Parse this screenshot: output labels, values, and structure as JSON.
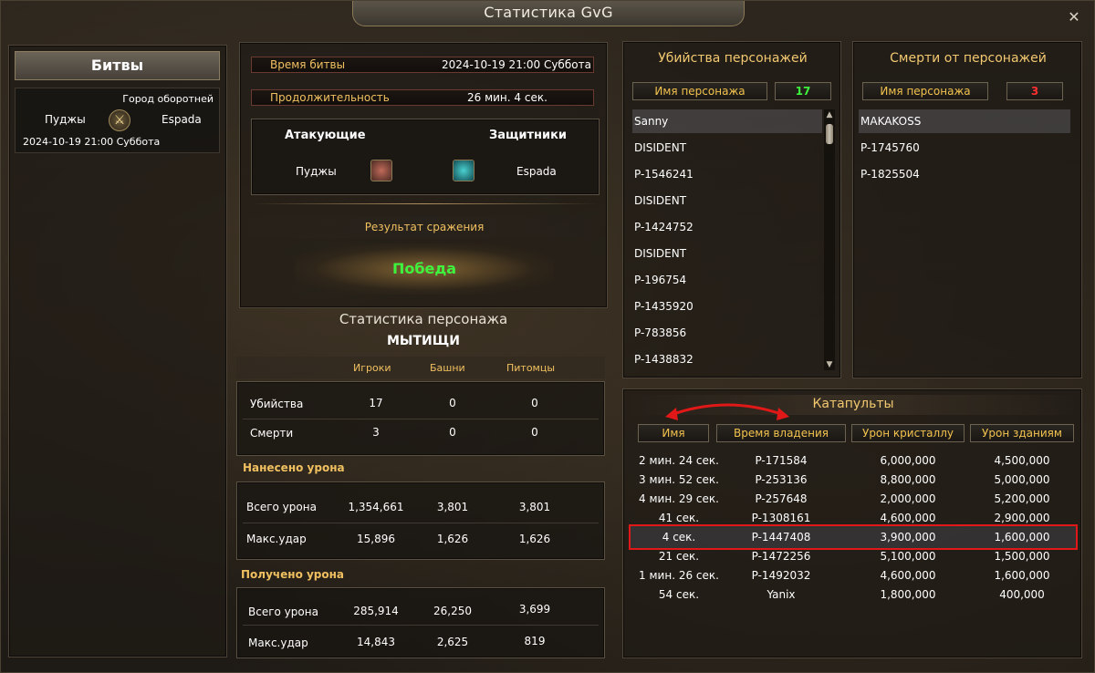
{
  "window": {
    "title": "Статистика GvG",
    "close_icon": "close-icon"
  },
  "battles": {
    "header": "Битвы",
    "entry": {
      "location": "Город оборотней",
      "attacker": "Пуджы",
      "defender": "Espada",
      "datetime": "2024-10-19 21:00 Суббота"
    }
  },
  "battle_info": {
    "time_label": "Время битвы",
    "time_value": "2024-10-19 21:00 Суббота",
    "duration_label": "Продолжительность",
    "duration_value": "26 мин. 4 сек.",
    "attackers_label": "Атакующие",
    "defenders_label": "Защитники",
    "attacker_name": "Пуджы",
    "defender_name": "Espada",
    "result_label": "Результат сражения",
    "result_value": "Победа"
  },
  "char_stats": {
    "title": "Статистика персонажа",
    "name": "МЫТИЩИ",
    "columns": [
      "Игроки",
      "Башни",
      "Питомцы"
    ],
    "rows": [
      {
        "label": "Убийства",
        "values": [
          "17",
          "0",
          "0"
        ]
      },
      {
        "label": "Смерти",
        "values": [
          "3",
          "0",
          "0"
        ]
      }
    ],
    "damage_dealt_label": "Нанесено урона",
    "damage_dealt": [
      {
        "label": "Всего урона",
        "values": [
          "1,354,661",
          "3,801",
          "3,801"
        ]
      },
      {
        "label": "Макс.удар",
        "values": [
          "15,896",
          "1,626",
          "1,626"
        ]
      }
    ],
    "damage_taken_label": "Получено урона",
    "damage_taken": [
      {
        "label": "Всего урона",
        "values": [
          "285,914",
          "26,250",
          "3,699"
        ]
      },
      {
        "label": "Макс.удар",
        "values": [
          "14,843",
          "2,625",
          "819"
        ]
      }
    ]
  },
  "kills": {
    "title": "Убийства персонажей",
    "col_label": "Имя персонажа",
    "count": "17",
    "items": [
      "Sanny",
      "DISIDENT",
      "P-1546241",
      "DISIDENT",
      "P-1424752",
      "DISIDENT",
      "P-196754",
      "P-1435920",
      "P-783856",
      "P-1438832"
    ]
  },
  "deaths": {
    "title": "Смерти от персонажей",
    "col_label": "Имя персонажа",
    "count": "3",
    "items": [
      "MAKAKOSS",
      "P-1745760",
      "P-1825504"
    ]
  },
  "catapults": {
    "title": "Катапульты",
    "columns": [
      "Имя",
      "Время владения",
      "Урон кристаллу",
      "Урон зданиям"
    ],
    "rows": [
      [
        "2 мин. 24 сек.",
        "P-171584",
        "6,000,000",
        "4,500,000"
      ],
      [
        "3 мин. 52 сек.",
        "P-253136",
        "8,800,000",
        "5,000,000"
      ],
      [
        "4 мин. 29 сек.",
        "P-257648",
        "2,000,000",
        "5,200,000"
      ],
      [
        "41 сек.",
        "P-1308161",
        "4,600,000",
        "2,900,000"
      ],
      [
        "4 сек.",
        "P-1447408",
        "3,900,000",
        "1,600,000"
      ],
      [
        "21 сек.",
        "P-1472256",
        "5,100,000",
        "1,500,000"
      ],
      [
        "1 мин. 26 сек.",
        "P-1492032",
        "4,600,000",
        "1,600,000"
      ],
      [
        "54 сек.",
        "Yanix",
        "1,800,000",
        "400,000"
      ]
    ],
    "highlight_color": "#e01818",
    "arrow_color": "#e01818"
  }
}
